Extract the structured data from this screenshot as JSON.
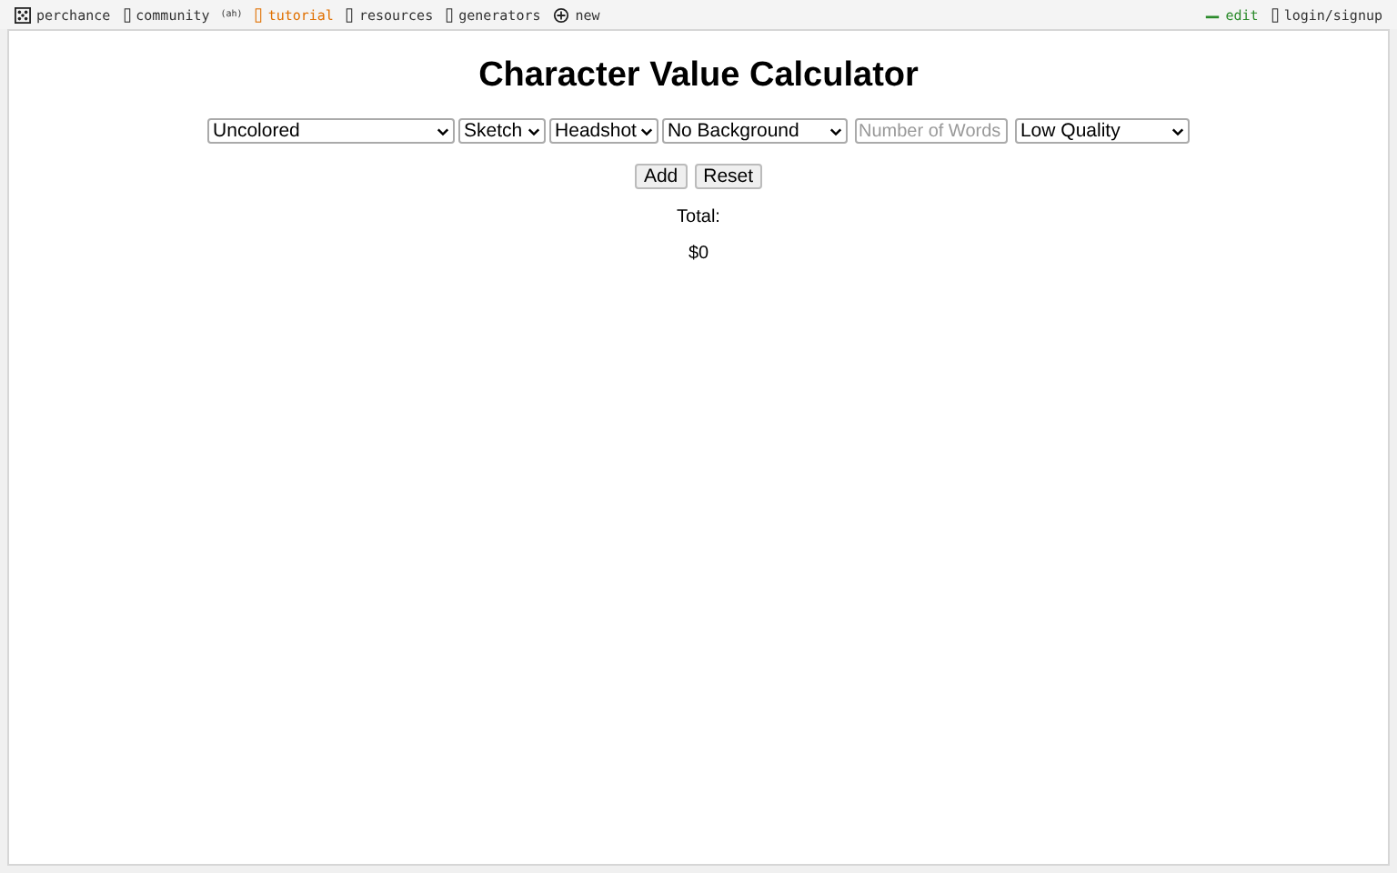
{
  "nav_left": [
    {
      "label": "perchance",
      "color": "#333333"
    },
    {
      "label": "community",
      "color": "#333333",
      "badge": "(ah)"
    },
    {
      "label": "tutorial",
      "color": "#e07000"
    },
    {
      "label": "resources",
      "color": "#333333"
    },
    {
      "label": "generators",
      "color": "#333333"
    },
    {
      "label": "new",
      "color": "#333333"
    }
  ],
  "nav_right": [
    {
      "label": "edit",
      "color": "#2a8a2a"
    },
    {
      "label": "login/signup",
      "color": "#333333"
    }
  ],
  "title": "Character Value Calculator",
  "controls": [
    {
      "kind": "select",
      "value": "Uncolored"
    },
    {
      "kind": "select",
      "value": "Sketch"
    },
    {
      "kind": "select",
      "value": "Headshot"
    },
    {
      "kind": "select",
      "value": "No Background"
    },
    {
      "kind": "input",
      "placeholder": "Number of Words"
    },
    {
      "kind": "select",
      "value": "Low Quality"
    }
  ],
  "buttons": [
    "Add",
    "Reset"
  ],
  "total_label": "Total:",
  "total_value": "$0"
}
